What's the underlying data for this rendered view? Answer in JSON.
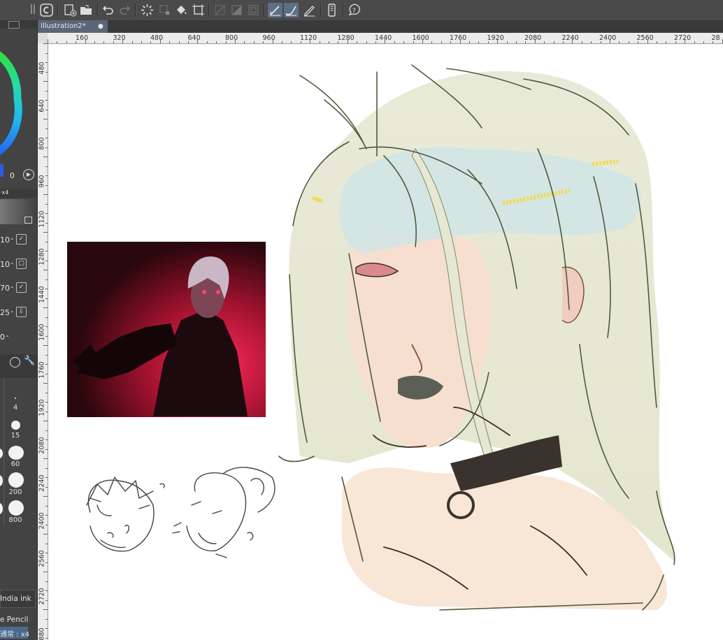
{
  "document_tab": {
    "title": "Illustration2*",
    "close_glyph": "●"
  },
  "toolbar": {
    "icons": [
      "clip-studio-icon",
      "new-canvas-icon",
      "open-folder-icon",
      "undo-icon",
      "redo-icon",
      "selection-spinner-icon",
      "transform-icon",
      "fill-icon",
      "crop-icon",
      "hide-selection-icon",
      "selection-border-icon",
      "snap-ruler-icon",
      "pen-line-icon",
      "brush-stroke-icon",
      "pencil-stroke-icon",
      "device-icon",
      "help-icon"
    ]
  },
  "left_panel": {
    "color_value": "0",
    "layer_label": "·x4",
    "brush_values": [
      "10",
      "10",
      "70",
      "25",
      "0"
    ],
    "brush_sizes": [
      "4",
      "15",
      "60",
      "200",
      "800"
    ],
    "tool_names": [
      "India ink",
      "e Pencil"
    ],
    "blend_label": "通常 : x4"
  },
  "rulers": {
    "horizontal": [
      "160",
      "320",
      "480",
      "640",
      "800",
      "960",
      "1120",
      "1280",
      "1440",
      "1600",
      "1760",
      "1920",
      "2080",
      "2240",
      "2400",
      "2560",
      "2720",
      "28"
    ],
    "vertical": [
      "480",
      "640",
      "800",
      "960",
      "1120",
      "1280",
      "1440",
      "1600",
      "1760",
      "1920",
      "2080",
      "2240",
      "2400",
      "2560",
      "2720",
      "880"
    ]
  }
}
